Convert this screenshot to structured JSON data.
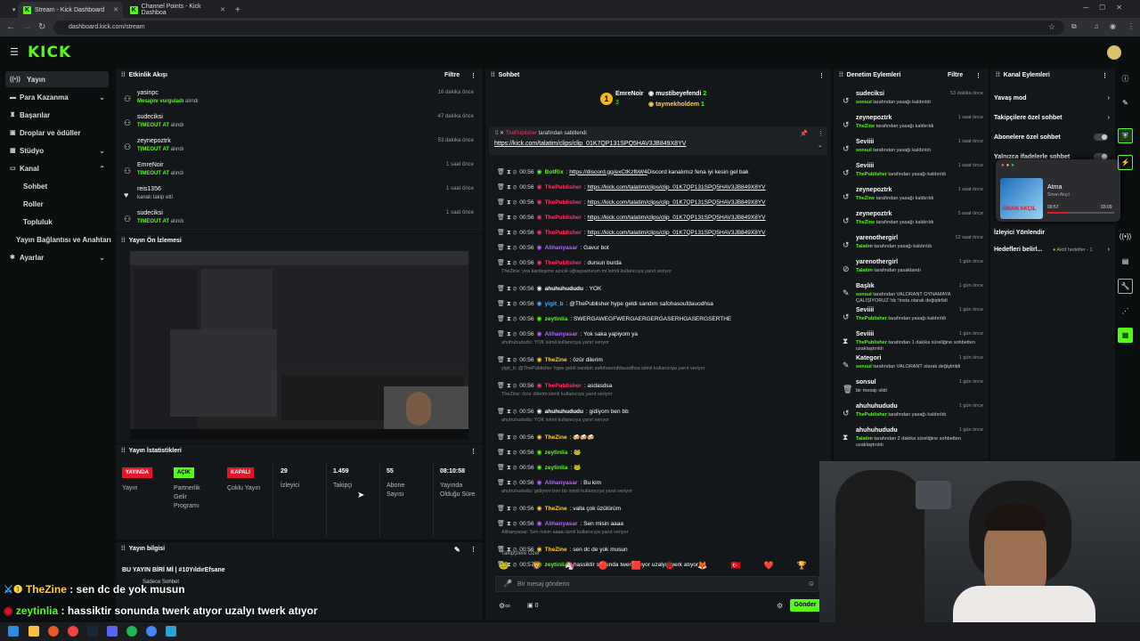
{
  "browser": {
    "tabs": [
      {
        "label": "Stream - Kick Dashboard"
      },
      {
        "label": "Channel Points - Kick Dashboa"
      }
    ],
    "url": "dashboard.kick.com/stream"
  },
  "logo": "KICK",
  "sidebar": {
    "items": [
      {
        "label": "Yayın",
        "icon": "broadcast-icon"
      },
      {
        "label": "Para Kazanma",
        "icon": "money-icon"
      },
      {
        "label": "Başarılar",
        "icon": "trophy-icon"
      },
      {
        "label": "Droplar ve ödüller",
        "icon": "gift-icon"
      },
      {
        "label": "Stüdyo",
        "icon": "studio-icon"
      },
      {
        "label": "Kanal",
        "icon": "channel-icon"
      },
      {
        "label": "Yayın Bağlantısı ve Anahtarı"
      },
      {
        "label": "Ayarlar",
        "icon": "gear-icon"
      }
    ],
    "kanal_sub": [
      "Sohbet",
      "Roller",
      "Topluluk"
    ]
  },
  "activity": {
    "title": "Etkinlik Akışı",
    "filter": "Filtre",
    "rows": [
      {
        "name": "yasinpc",
        "desc_em": "Mesajını vurguladı",
        "desc": " alındı",
        "time": "16 dakika önce"
      },
      {
        "name": "sudeciksi",
        "desc_em": "TIMEOUT AT",
        "desc": " alındı",
        "time": "47 dakika önce"
      },
      {
        "name": "zeynepoztrk",
        "desc_em": "TIMEOUT AT",
        "desc": " alındı",
        "time": "53 dakika önce"
      },
      {
        "name": "EmreNoir",
        "desc_em": "TIMEOUT AT",
        "desc": " alındı",
        "time": "1 saat önce"
      },
      {
        "name": "reis1356",
        "desc_em": "",
        "desc": "kanalı takip etti",
        "time": "1 saat önce"
      },
      {
        "name": "sudeciksi",
        "desc_em": "TIMEOUT AT",
        "desc": " alındı",
        "time": "1 saat önce"
      }
    ]
  },
  "preview": {
    "title": "Yayın Ön İzlemesi"
  },
  "stats": {
    "title": "Yayın İstatistikleri",
    "items": [
      {
        "badge": "YAYINDA",
        "color": "#e0162b",
        "label": "Yayın"
      },
      {
        "badge": "AÇIK",
        "color": "#53fc18",
        "label": "Partnerlik Gelir Programı"
      },
      {
        "badge": "KAPALI",
        "color": "#e0162b",
        "label": "Çoklu Yayın"
      },
      {
        "value": "29",
        "label": "İzleyici"
      },
      {
        "value": "1.459",
        "label": "Takipçi"
      },
      {
        "value": "55",
        "label": "Abone Sayısı"
      },
      {
        "value": "08:10:58",
        "label": "Yayında Olduğu Süre"
      }
    ]
  },
  "info": {
    "title": "Yayın bilgisi",
    "stream_title": "BU YAYIN BİRİ Mİ | #10YıldırEfsane",
    "mode": "Sadece Sohbet"
  },
  "chat": {
    "title": "Sohbet",
    "top": [
      {
        "name": "EmreNoir",
        "count": "3"
      },
      {
        "name": "mustibeyefendi",
        "count": "2"
      },
      {
        "name": "taymekholdem",
        "count": "1"
      }
    ],
    "pinned": {
      "user": "ThePublisher",
      "text": "tarafından sabitlendi",
      "link": "https://kick.com/talatim/clips/clip_01K7QP131SPQ5HAV3JB849X8YV"
    },
    "messages": [
      {
        "time": "00:56",
        "user": "BotRix",
        "color": "#53fc18",
        "text": "https://discord.gg/exCtKzfbW4",
        "text2": " Discord kanalımız fena iyi kesin gel bak",
        "link": true
      },
      {
        "time": "00:56",
        "user": "ThePublisher",
        "color": "#ff3366",
        "text": "https://kick.com/talatim/clips/clip_01K7QP131SPQ5HAV3JB849X8YV",
        "link": true
      },
      {
        "time": "00:56",
        "user": "ThePublisher",
        "color": "#ff3366",
        "text": "https://kick.com/talatim/clips/clip_01K7QP131SPQ5HAV3JB849X8YV",
        "link": true
      },
      {
        "time": "00:56",
        "user": "ThePublisher",
        "color": "#ff3366",
        "text": "https://kick.com/talatim/clips/clip_01K7QP131SPQ5HAV3JB849X8YV",
        "link": true
      },
      {
        "time": "00:56",
        "user": "ThePublisher",
        "color": "#ff3366",
        "text": "https://kick.com/talatim/clips/clip_01K7QP131SPQ5HAV3JB849X8YV",
        "link": true
      },
      {
        "time": "00:56",
        "user": "Alihanyasar",
        "color": "#b266ff",
        "text": "Gavur bot"
      },
      {
        "time": "00:56",
        "user": "ThePublisher",
        "color": "#ff3366",
        "text": "dursun burda"
      },
      {
        "reply": "TheZine: yea kardeşime azıcık uğraşsamıcım mi isimli kullanıcıya yanıt veriyor"
      },
      {
        "time": "00:56",
        "user": "ahuhuhududu",
        "color": "#ffffff",
        "text": "YOK"
      },
      {
        "time": "00:56",
        "user": "yigit_b",
        "color": "#53a8ff",
        "text": "@ThePublisher hype geldi sandım safohasoufdauodhsa"
      },
      {
        "time": "00:56",
        "user": "zeytinlia",
        "color": "#53fc18",
        "text": "SWERGAWEGFWERGAERGERGASERHGASERGSERTHE"
      },
      {
        "time": "00:56",
        "user": "Alihanyasar",
        "color": "#b266ff",
        "text": "Yok saka yapiyom ya"
      },
      {
        "reply": "ahuhuhududu: YOK isimli kullanıcıya yanıt veriyor"
      },
      {
        "time": "00:56",
        "user": "TheZine",
        "color": "#ffd23a",
        "text": "özür dilerim"
      },
      {
        "reply": "yigit_b: @ThePublisher hype geldi sandım safohasoufdauodhsa isimli kullanıcıya yanıt veriyor"
      },
      {
        "time": "00:56",
        "user": "ThePublisher",
        "color": "#ff3366",
        "text": "asdasdsa"
      },
      {
        "reply": "TheZine: özür dilerim isimli kullanıcıya yanıt veriyor"
      },
      {
        "time": "00:56",
        "user": "ahuhuhududu",
        "color": "#ffffff",
        "text": "gidiyom ben bb"
      },
      {
        "reply": "ahuhuhududu: YOK isimli kullanıcıya yanıt veriyor"
      },
      {
        "time": "00:56",
        "user": "TheZine",
        "color": "#ffd23a",
        "text": "🍻🍻🍻"
      },
      {
        "time": "00:56",
        "user": "zeytinlia",
        "color": "#53fc18",
        "text": "🐸"
      },
      {
        "time": "00:56",
        "user": "zeytinlia",
        "color": "#53fc18",
        "text": "🐸"
      },
      {
        "time": "00:56",
        "user": "Alihanyasar",
        "color": "#b266ff",
        "text": "Bu kim"
      },
      {
        "reply": "ahuhuhududu: gidiyom ben bb isimli kullanıcıya yanıt veriyor"
      },
      {
        "time": "00:56",
        "user": "TheZine",
        "color": "#ffd23a",
        "text": "valla çok üzülürüm"
      },
      {
        "time": "00:56",
        "user": "Alihanyasar",
        "color": "#b266ff",
        "text": "Sen misin aaaa"
      },
      {
        "reply": "Alihanyasar: Sen misin aaaa isimli kullanıcıya yanıt veriyor"
      },
      {
        "time": "00:56",
        "user": "TheZine",
        "color": "#ffd23a",
        "text": "sen dc de yok musun"
      },
      {
        "time": "00:57",
        "user": "zeytinlia",
        "color": "#53fc18",
        "text": "hassiktir sonunda twerk atıyor uzalyı twerk atıyor"
      }
    ],
    "followers_special": "Takipçilere Özel",
    "input_placeholder": "Bir mesaj gönderin",
    "points": "0",
    "send": "Gönder"
  },
  "moderation": {
    "title": "Denetim Eylemleri",
    "filter": "Filtre",
    "rows": [
      {
        "name": "sudeciksi",
        "who": "sonsul",
        "desc": " tarafından yasağı kaldırıldı",
        "time": "53 dakika önce",
        "icon": "undo-icon"
      },
      {
        "name": "zeynepoztrk",
        "who": "TheZine",
        "desc": " tarafından yasağı kaldırıldı",
        "time": "1 saat önce",
        "icon": "undo-icon"
      },
      {
        "name": "Seviiii",
        "who": "sonsul",
        "desc": " tarafından yasağı kaldırıldı",
        "time": "1 saat önce",
        "icon": "undo-icon"
      },
      {
        "name": "Seviiii",
        "who": "ThePublisher",
        "desc": " tarafından yasağı kaldırıldı",
        "time": "1 saat önce",
        "icon": "undo-icon"
      },
      {
        "name": "zeynepoztrk",
        "who": "TheZine",
        "desc": " tarafından yasağı kaldırıldı",
        "time": "1 saat önce",
        "icon": "undo-icon"
      },
      {
        "name": "zeynepoztrk",
        "who": "TheZine",
        "desc": " tarafından yasağı kaldırıldı",
        "time": "5 saat önce",
        "icon": "undo-icon"
      },
      {
        "name": "yarenothergirl",
        "who": "Talatim",
        "desc": " tarafından yasağı kaldırıldı",
        "time": "12 saat önce",
        "icon": "undo-icon"
      },
      {
        "name": "yarenothergirl",
        "who": "Talatim",
        "desc": " tarafından yasaklandı",
        "time": "1 gün önce",
        "icon": "ban-icon"
      },
      {
        "name": "Başlık",
        "who": "sonsul",
        "desc": " tarafından VALORANT OYNAMAYA ÇALIŞIYORUZ !dc !insta olarak değiştirildi",
        "time": "1 gün önce",
        "icon": "pencil-icon"
      },
      {
        "name": "Seviiii",
        "who": "ThePublisher",
        "desc": " tarafından yasağı kaldırıldı",
        "time": "1 gün önce",
        "icon": "undo-icon"
      },
      {
        "name": "Seviiii",
        "who": "ThePublisher",
        "desc": " tarafından 1 dakika süreliğine sohbetten uzaklaştırıldı",
        "time": "1 gün önce",
        "icon": "hourglass-icon"
      },
      {
        "name": "Kategori",
        "who": "sonsul",
        "desc": " tarafından VALORANT olarak değiştirildi",
        "time": "1 gün önce",
        "icon": "pencil-icon"
      },
      {
        "name": "sonsul",
        "who": "",
        "desc": "bir mesajı sildi",
        "time": "1 gün önce",
        "icon": "trash-icon"
      },
      {
        "name": "ahuhuhududu",
        "who": "ThePublisher",
        "desc": " tarafından yasağı kaldırıldı",
        "time": "1 gün önce",
        "icon": "undo-icon"
      },
      {
        "name": "ahuhuhududu",
        "who": "Talatim",
        "desc": " tarafından 2 dakika süreliğine sohbetten uzaklaştırıldı",
        "time": "1 gün önce",
        "icon": "hourglass-icon"
      }
    ]
  },
  "kanal": {
    "title": "Kanal Eylemleri",
    "rows": [
      {
        "label": "Yavaş mod"
      },
      {
        "label": "Takipçilere özel sohbet"
      },
      {
        "label": "Abonelere özel sohbet"
      },
      {
        "label": "Yalnızca ifadelerle sohbet"
      },
      {
        "label": "İzleyici Yönlendir"
      },
      {
        "label": "Hedefleri belirl...",
        "extra": "Aktif hedefler - 1"
      }
    ]
  },
  "music": {
    "title": "Atma",
    "artist": "Sinan Akçıl",
    "elapsed": "00:57",
    "total": "03:09",
    "cover_text": "SİNAN AKÇIL",
    "progress": 0.3
  },
  "overlay": [
    {
      "user": "TheZine",
      "text": "sen dc de yok musun"
    },
    {
      "user": "zeytinlia",
      "text": "hassiktir sonunda twerk atıyor uzalyı twerk atıyor"
    }
  ],
  "colors": {
    "accent": "#53fc18",
    "live": "#e0162b"
  }
}
